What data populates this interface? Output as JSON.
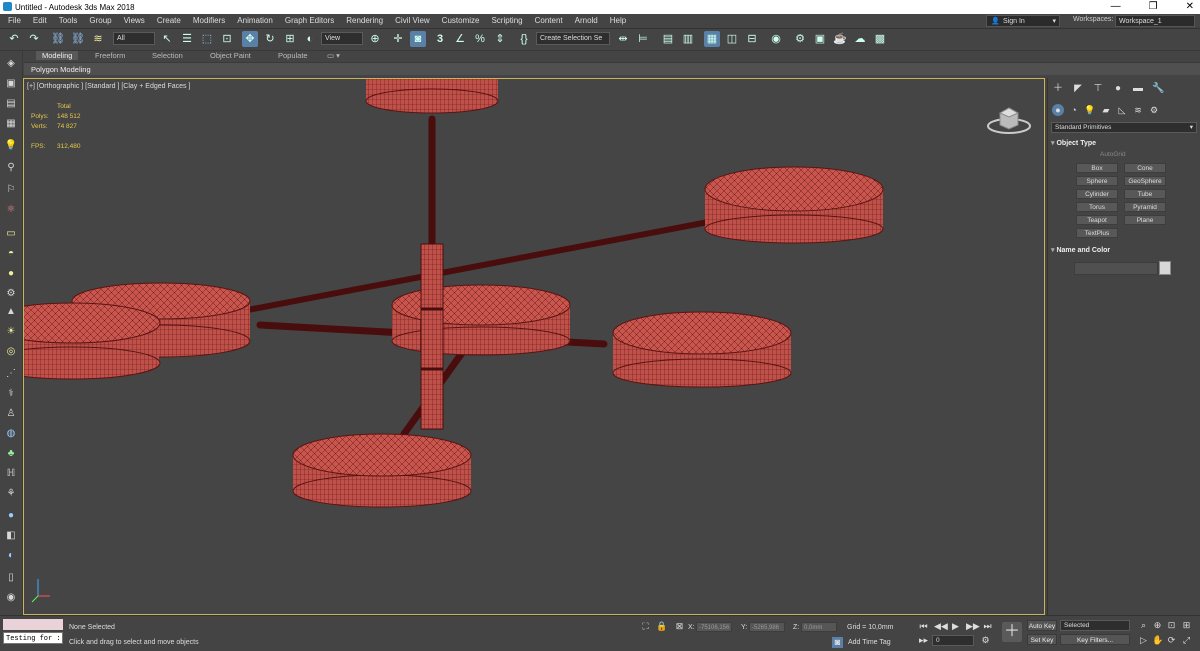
{
  "titlebar": {
    "title": "Untitled - Autodesk 3ds Max 2018",
    "minimize": "—",
    "maximize": "❐",
    "close": "✕"
  },
  "menubar": {
    "items": [
      "File",
      "Edit",
      "Tools",
      "Group",
      "Views",
      "Create",
      "Modifiers",
      "Animation",
      "Graph Editors",
      "Rendering",
      "Civil View",
      "Customize",
      "Scripting",
      "Content",
      "Arnold",
      "Help"
    ],
    "signin": "Sign In",
    "workspaces_label": "Workspaces:",
    "workspace_value": "Workspace_1"
  },
  "toolbar": {
    "selection_filter": "All",
    "ref_coord": "View",
    "named_selection": "Create Selection Se",
    "snap_value": "3"
  },
  "ribbon": {
    "tabs": [
      "Modeling",
      "Freeform",
      "Selection",
      "Object Paint",
      "Populate"
    ],
    "active_tab": "Modeling",
    "panel_label": "Polygon Modeling"
  },
  "viewport": {
    "label": "[+] [Orthographic ] [Standard ] [Clay + Edged Faces ]",
    "stats": {
      "total_label": "Total",
      "polys_label": "Polys:",
      "polys_value": "148 512",
      "verts_label": "Verts:",
      "verts_value": "74 827",
      "fps_label": "FPS:",
      "fps_value": "312,480"
    },
    "mesh_color": "#c8564e",
    "rod_color": "#4a0d0d",
    "border_color": "#c9b45a"
  },
  "command_panel": {
    "category": "Standard Primitives",
    "object_type_title": "Object Type",
    "autogrid": "AutoGrid",
    "buttons": [
      "Box",
      "Cone",
      "Sphere",
      "GeoSphere",
      "Cylinder",
      "Tube",
      "Torus",
      "Pyramid",
      "Teapot",
      "Plane",
      "TextPlus"
    ],
    "name_color_title": "Name and Color"
  },
  "statusbar": {
    "maxscript_text": "Testing for :",
    "selection_status": "None Selected",
    "prompt": "Click and drag to select and move objects",
    "x_label": "X:",
    "x_value": "-75106,156",
    "y_label": "Y:",
    "y_value": "-5265,986",
    "z_label": "Z:",
    "z_value": "0,0mm",
    "grid": "Grid = 10,0mm",
    "add_time_tag": "Add Time Tag",
    "frame_value": "0",
    "auto_key": "Auto Key",
    "set_key": "Set Key",
    "key_mode": "Selected",
    "key_filters": "Key Filters..."
  }
}
